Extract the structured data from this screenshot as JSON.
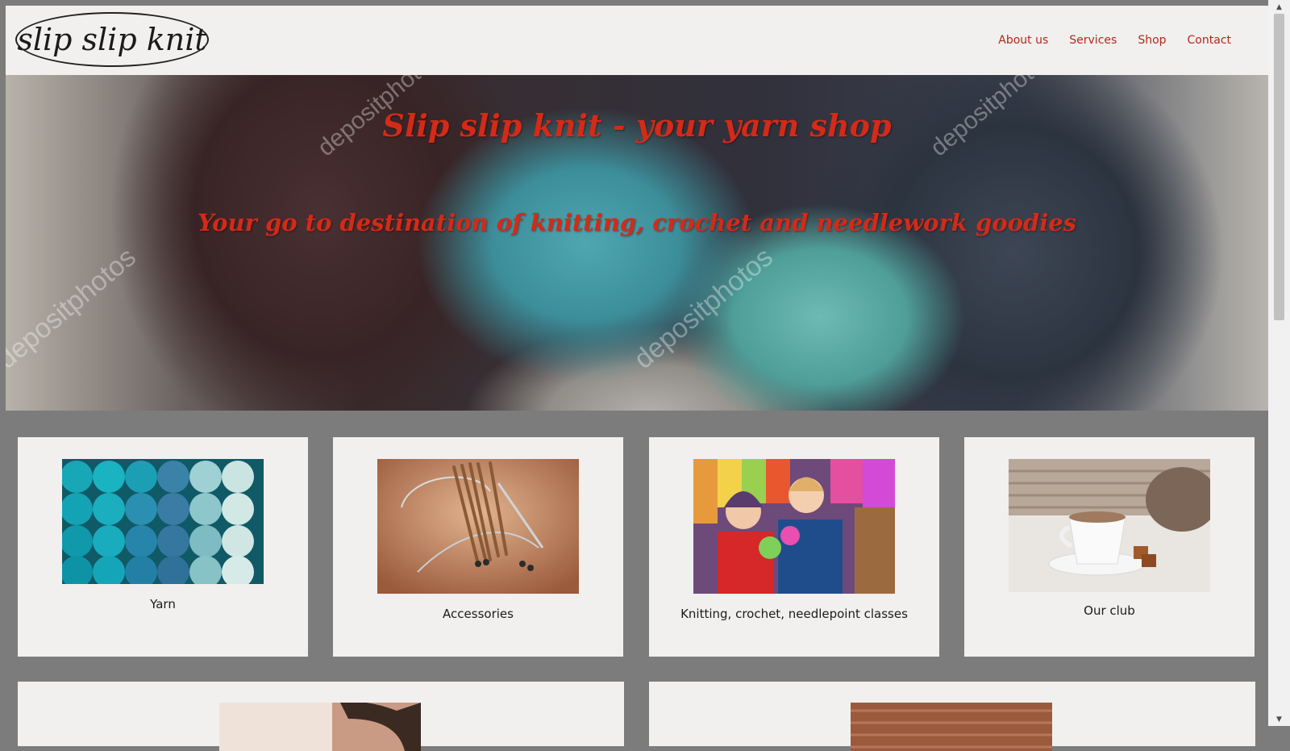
{
  "header": {
    "logo_text": "slip slip knit",
    "nav": [
      "About us",
      "Services",
      "Shop",
      "Contact"
    ]
  },
  "hero": {
    "title": "Slip slip knit - your yarn shop",
    "subtitle": "Your go to destination of knitting, crochet and needlework goodies",
    "watermark": "depositphotos"
  },
  "cards": [
    {
      "label": "Yarn",
      "image_icon": "yarn-balls-image"
    },
    {
      "label": "Accessories",
      "image_icon": "knitting-needles-image"
    },
    {
      "label": "Knitting, crochet, needlepoint classes",
      "image_icon": "yarn-shop-women-image"
    },
    {
      "label": "Our club",
      "image_icon": "coffee-cup-knitwear-image"
    }
  ],
  "colors": {
    "accent": "#d42a18",
    "nav_link": "#b3281b",
    "page_bg": "#7c7c7c",
    "card_bg": "#f1f0ee"
  }
}
